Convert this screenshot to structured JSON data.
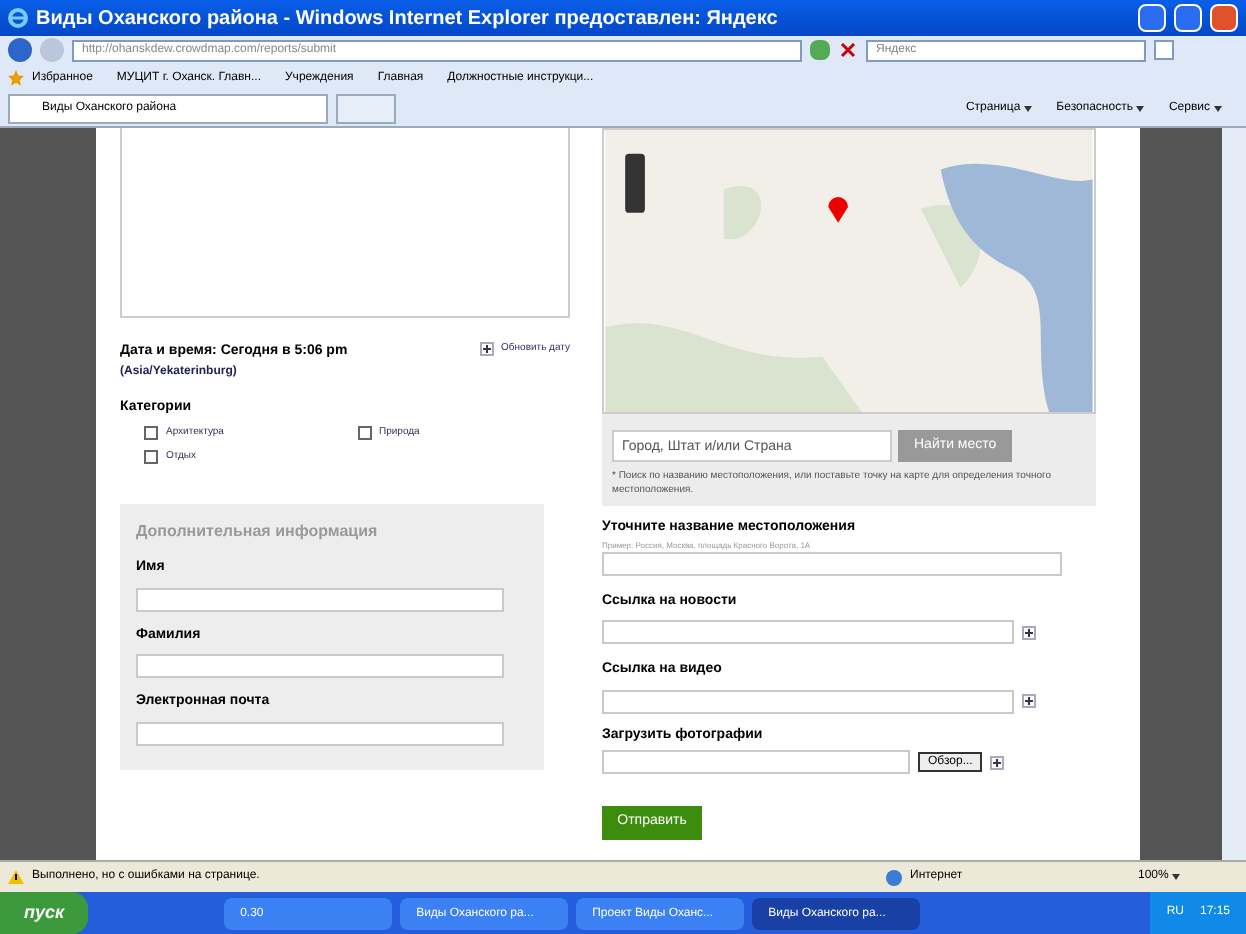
{
  "window": {
    "title": "Виды Оханского района - Windows Internet Explorer предоставлен: Яндекс"
  },
  "address_bar": {
    "url": "http://ohanskdew.crowdmap.com/reports/submit",
    "search_placeholder": "Яндекс"
  },
  "favorites_bar": {
    "favorites": "Избранное",
    "links": [
      "МУЦИТ г. Оханск. Главн...",
      "Учреждения",
      "Главная",
      "Должностные инструкци..."
    ]
  },
  "tab": {
    "label": "Виды Оханского района",
    "selected": true
  },
  "command_bar": [
    "Страница",
    "Безопасность",
    "Сервис"
  ],
  "form": {
    "date_label": "Дата и время: Сегодня в 5:06 pm",
    "timezone": "(Asia/Yekaterinburg)",
    "update_date_link": "Обновить дату",
    "categories_label": "Категории",
    "categories": [
      {
        "label": "Архитектура",
        "checked": false
      },
      {
        "label": "Отдых",
        "checked": false
      },
      {
        "label": "Природа",
        "checked": false
      }
    ],
    "extra_title": "Дополнительная информация",
    "extra_fields": [
      "Имя",
      "Фамилия",
      "Электронная почта"
    ],
    "map_search": {
      "value": "Город, Штат и/или Страна",
      "button": "Найти место",
      "hint": "* Поиск по названию местоположения, или поставьте точку на карте для определения точного местоположения."
    },
    "location_label": "Уточните название местоположения",
    "location_hint": "Пример: Россия, Москва, площадь Красного Ворота, 1А",
    "news_label": "Ссылка на новости",
    "video_label": "Ссылка на видео",
    "photos_label": "Загрузить фотографии",
    "browse_button": "Обзор...",
    "submit": "Отправить"
  },
  "status_bar": {
    "text": "Выполнено, но с ошибками на странице.",
    "zone": "Интернет",
    "zoom": "100%"
  },
  "taskbar": {
    "start": "пуск",
    "items": [
      {
        "label": "0.30",
        "selected": false
      },
      {
        "label": "Виды Оханского ра...",
        "selected": false
      },
      {
        "label": "Проект Виды Оханс...",
        "selected": false
      },
      {
        "label": "Виды Оханского ра...",
        "selected": true
      }
    ],
    "lang": "RU",
    "time": "17:15"
  }
}
